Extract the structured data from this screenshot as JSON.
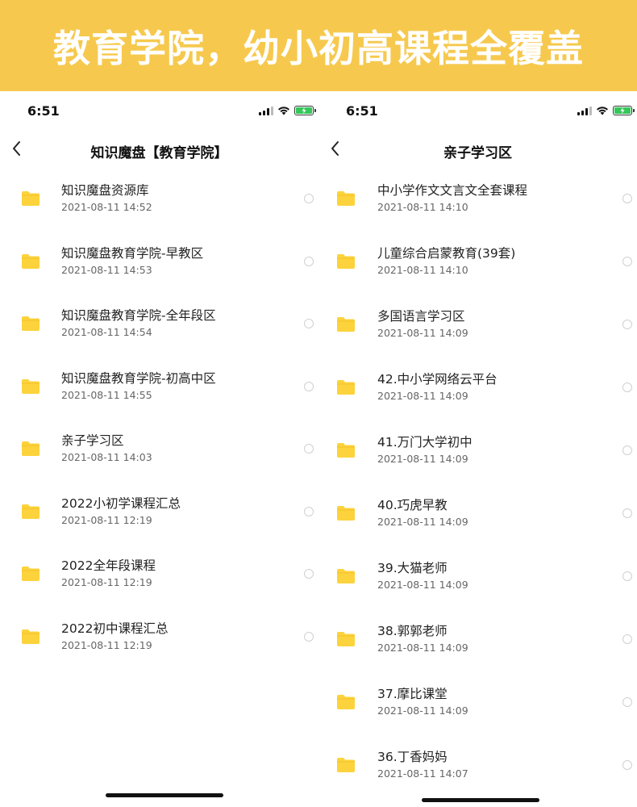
{
  "banner": {
    "title": "教育学院，幼小初高课程全覆盖"
  },
  "colors": {
    "banner_bg": "#f6c94e",
    "folder": "#fcd33c",
    "battery": "#34c759"
  },
  "left_panel": {
    "status": {
      "time": "6:51"
    },
    "nav": {
      "back_icon": "chevron-left-icon",
      "title": "知识魔盘【教育学院】"
    },
    "items": [
      {
        "name": "知识魔盘资源库",
        "date": "2021-08-11 14:52"
      },
      {
        "name": "知识魔盘教育学院-早教区",
        "date": "2021-08-11 14:53"
      },
      {
        "name": "知识魔盘教育学院-全年段区",
        "date": "2021-08-11 14:54"
      },
      {
        "name": "知识魔盘教育学院-初高中区",
        "date": "2021-08-11 14:55"
      },
      {
        "name": "亲子学习区",
        "date": "2021-08-11 14:03"
      },
      {
        "name": "2022小初学课程汇总",
        "date": "2021-08-11 12:19"
      },
      {
        "name": "2022全年段课程",
        "date": "2021-08-11 12:19"
      },
      {
        "name": "2022初中课程汇总",
        "date": "2021-08-11 12:19"
      }
    ]
  },
  "right_panel": {
    "status": {
      "time": "6:51"
    },
    "nav": {
      "back_icon": "chevron-left-icon",
      "title": "亲子学习区"
    },
    "items": [
      {
        "name": "中小学作文文言文全套课程",
        "date": "2021-08-11 14:10"
      },
      {
        "name": "儿童综合启蒙教育(39套)",
        "date": "2021-08-11 14:10"
      },
      {
        "name": "多国语言学习区",
        "date": "2021-08-11 14:09"
      },
      {
        "name": "42.中小学网络云平台",
        "date": "2021-08-11 14:09"
      },
      {
        "name": "41.万门大学初中",
        "date": "2021-08-11 14:09"
      },
      {
        "name": "40.巧虎早教",
        "date": "2021-08-11 14:09"
      },
      {
        "name": "39.大猫老师",
        "date": "2021-08-11 14:09"
      },
      {
        "name": "38.郭郭老师",
        "date": "2021-08-11 14:09"
      },
      {
        "name": "37.摩比课堂",
        "date": "2021-08-11 14:09"
      },
      {
        "name": "36.丁香妈妈",
        "date": "2021-08-11 14:07"
      }
    ]
  }
}
